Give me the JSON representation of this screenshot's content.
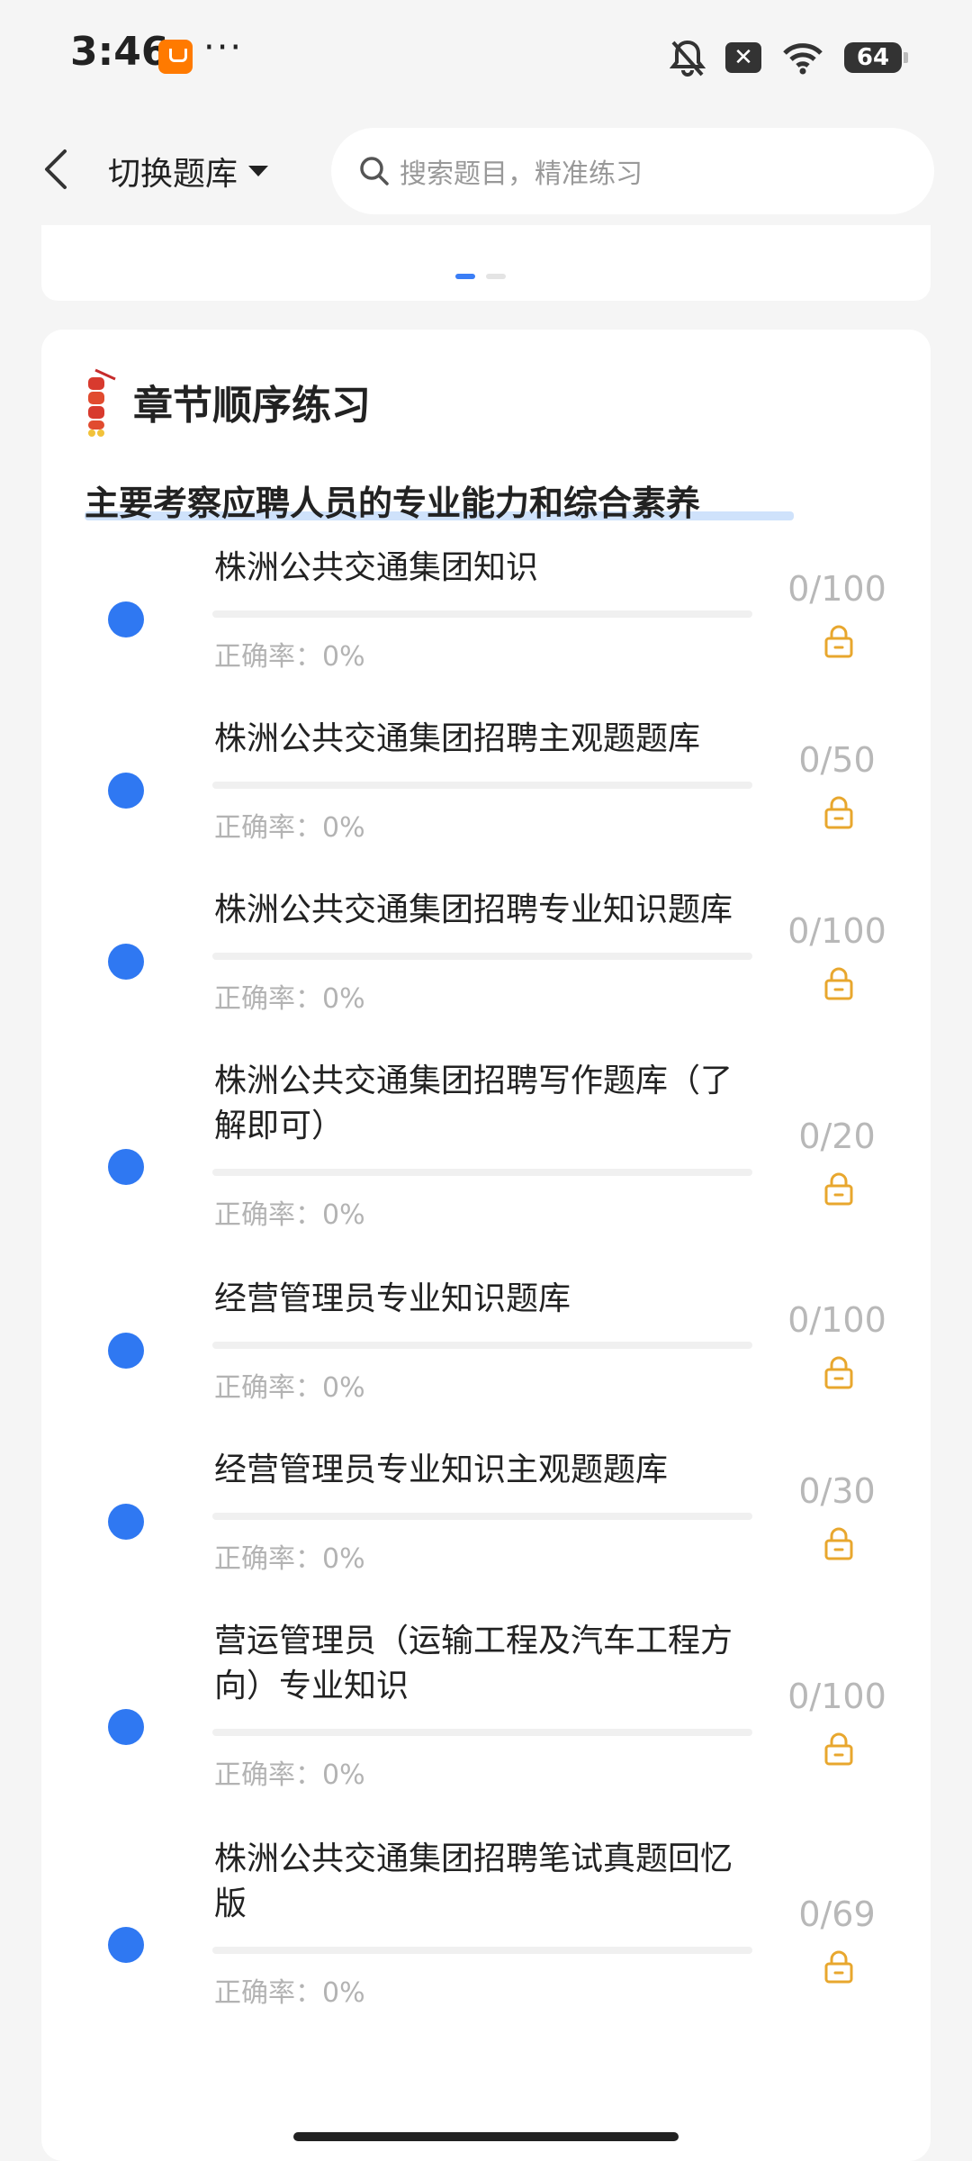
{
  "status_bar": {
    "time": "3:46",
    "battery": "64",
    "icons": [
      "shopping-bag-icon",
      "more-icon",
      "bell-off-icon",
      "close-box-icon",
      "wifi-icon",
      "battery-icon"
    ]
  },
  "header": {
    "switch_label": "切换题库",
    "search_placeholder": "搜索题目，精准练习"
  },
  "section": {
    "title": "章节顺序练习",
    "subtitle": "主要考察应聘人员的专业能力和综合素养"
  },
  "chapters": [
    {
      "title": "株洲公共交通集团知识",
      "rate": "正确率：0%",
      "count": "0/100",
      "progress": 0
    },
    {
      "title": "株洲公共交通集团招聘主观题题库",
      "rate": "正确率：0%",
      "count": "0/50",
      "progress": 0
    },
    {
      "title": "株洲公共交通集团招聘专业知识题库",
      "rate": "正确率：0%",
      "count": "0/100",
      "progress": 0
    },
    {
      "title": "株洲公共交通集团招聘写作题库（了解即可）",
      "rate": "正确率：0%",
      "count": "0/20",
      "progress": 0
    },
    {
      "title": "经营管理员专业知识题库",
      "rate": "正确率：0%",
      "count": "0/100",
      "progress": 0
    },
    {
      "title": "经营管理员专业知识主观题题库",
      "rate": "正确率：0%",
      "count": "0/30",
      "progress": 0
    },
    {
      "title": "营运管理员（运输工程及汽车工程方向）专业知识",
      "rate": "正确率：0%",
      "count": "0/100",
      "progress": 0
    },
    {
      "title": "株洲公共交通集团招聘笔试真题回忆版",
      "rate": "正确率：0%",
      "count": "0/69",
      "progress": 0
    }
  ],
  "colors": {
    "accent": "#2f78f2",
    "lock": "#e8a72e"
  }
}
